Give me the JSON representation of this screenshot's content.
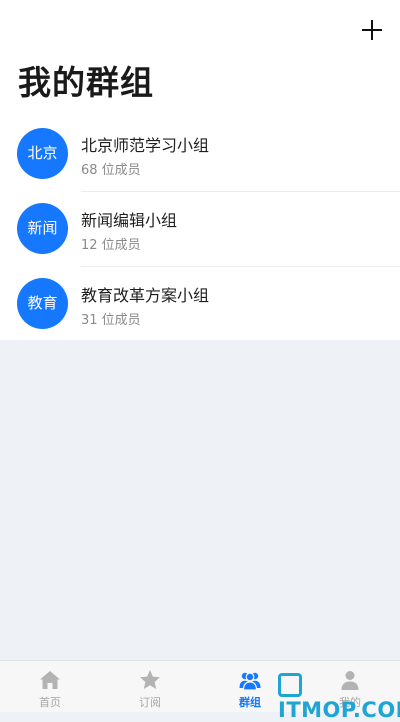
{
  "header": {
    "title": "我的群组",
    "add_icon": "plus-icon"
  },
  "groups": [
    {
      "avatar_text": "北京",
      "name": "北京师范学习小组",
      "members": "68 位成员"
    },
    {
      "avatar_text": "新闻",
      "name": "新闻编辑小组",
      "members": "12 位成员"
    },
    {
      "avatar_text": "教育",
      "name": "教育改革方案小组",
      "members": "31 位成员"
    }
  ],
  "tabbar": {
    "tabs": [
      {
        "label": "首页",
        "icon": "home-icon",
        "active": false
      },
      {
        "label": "订阅",
        "icon": "star-icon",
        "active": false
      },
      {
        "label": "群组",
        "icon": "group-icon",
        "active": true
      },
      {
        "label": "我的",
        "icon": "person-icon",
        "active": false
      }
    ]
  },
  "watermark": "ITMOP.COM",
  "colors": {
    "accent": "#1677ff",
    "inactive": "#a6a6a6",
    "background": "#eef1f5",
    "watermark": "#1fa5d4"
  }
}
